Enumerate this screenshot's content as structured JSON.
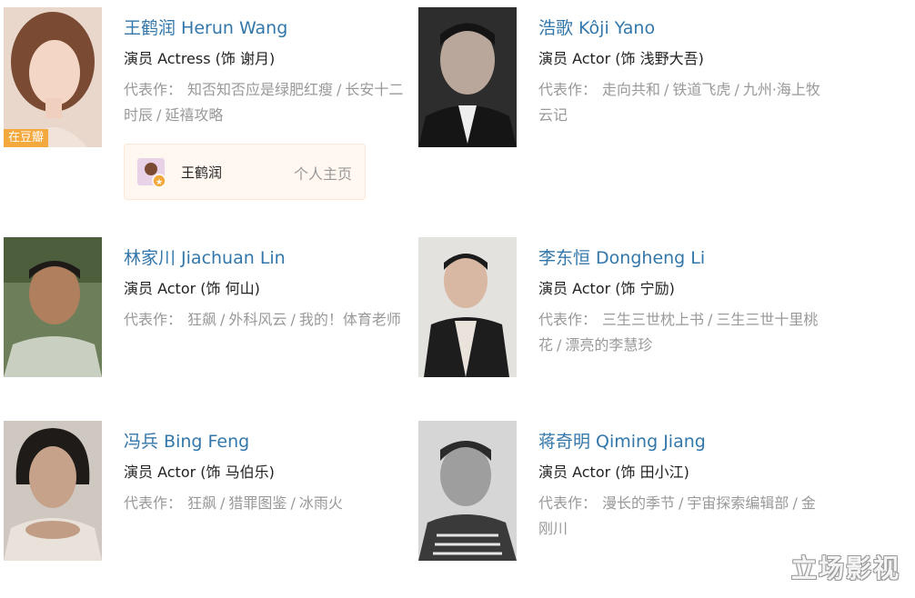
{
  "cast": [
    {
      "name": "王鹤润 Herun Wang",
      "role": "演员 Actress (饰 谢月)",
      "works_label": "代表作：",
      "works": [
        "知否知否应是绿肥红瘦",
        "长安十二时辰",
        "延禧攻略"
      ],
      "badge": "在豆瓣",
      "homepage": {
        "name": "王鹤润",
        "link": "个人主页"
      }
    },
    {
      "name": "浩歌 Kôji Yano",
      "role": "演员 Actor (饰 浅野大吾)",
      "works_label": "代表作：",
      "works": [
        "走向共和",
        "铁道飞虎",
        "九州·海上牧云记"
      ]
    },
    {
      "name": "林家川 Jiachuan Lin",
      "role": "演员 Actor (饰 何山)",
      "works_label": "代表作：",
      "works": [
        "狂飙",
        "外科风云",
        "我的！体育老师"
      ]
    },
    {
      "name": "李东恒 Dongheng Li",
      "role": "演员 Actor (饰 宁励)",
      "works_label": "代表作：",
      "works": [
        "三生三世枕上书",
        "三生三世十里桃花",
        "漂亮的李慧珍"
      ]
    },
    {
      "name": "冯兵 Bing Feng",
      "role": "演员 Actor (饰 马伯乐)",
      "works_label": "代表作：",
      "works": [
        "狂飙",
        "猎罪图鉴",
        "冰雨火"
      ]
    },
    {
      "name": "蒋奇明 Qiming Jiang",
      "role": "演员 Actor (饰 田小江)",
      "works_label": "代表作：",
      "works": [
        "漫长的季节",
        "宇宙探索编辑部",
        "金刚川"
      ]
    }
  ],
  "watermark": "立场影视",
  "colors": {
    "link": "#3377aa",
    "muted": "#999999",
    "badge": "#f3a93d",
    "home_bg": "#fff7f0"
  }
}
